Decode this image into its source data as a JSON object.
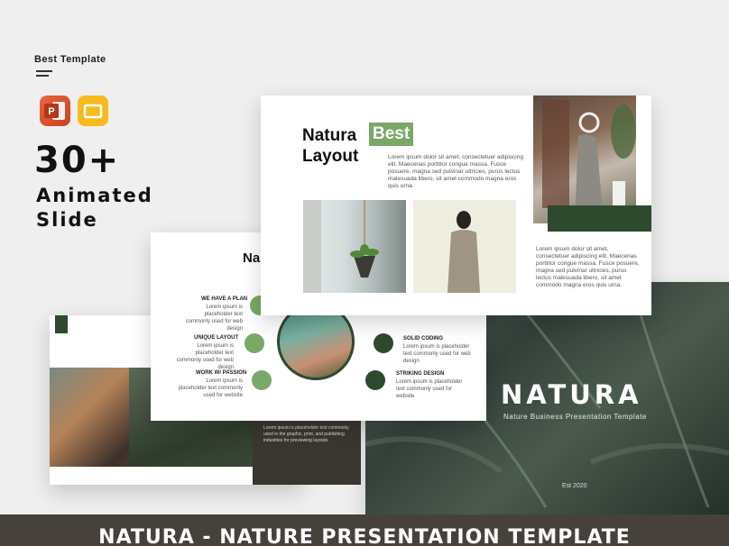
{
  "brand": {
    "name": "Best Template"
  },
  "apps": {
    "powerpoint_icon": "powerpoint-icon",
    "slides_icon": "google-slides-icon"
  },
  "promo": {
    "count": "30+",
    "line1": "Animated",
    "line2": "Slide"
  },
  "slide_layout": {
    "title_part1": "Natura",
    "title_highlight": "Best",
    "title_line2": "Layout",
    "body_top": "Lorem ipsum dolor sit amet, consectetuer adipiscing elit. Maecenas porttitor congue massa. Fusce posuere, magna sed pulvinar ultricies, purus lectus malesuada libero, sit amet commodo magna eros quis urna.",
    "body_bottom": "Lorem ipsum dolor sit amet, consectetuer adipiscing elit. Maecenas porttitor congue massa. Fusce posuere, magna sed pulvinar ultricies, purus lectus malesuada libero, sit amet commodo magna eros quis urna."
  },
  "slide_features": {
    "title_partial": "Na",
    "items": [
      {
        "title": "WE HAVE A PLAN",
        "text": "Lorem ipsum is placeholder text commonly used for web design"
      },
      {
        "title": "UNIQUE LAYOUT",
        "text": "Lorem ipsum is placeholder text commonly used for web design"
      },
      {
        "title": "WORK W/ PASSION",
        "text": "Lorem ipsum is placeholder text commonly used for website"
      },
      {
        "title": "SOLID CODING",
        "text": "Lorem ipsum is placeholder text commonly used for web design"
      },
      {
        "title": "STRIKING DESIGN",
        "text": "Lorem ipsum is placeholder text commonly used for website"
      }
    ]
  },
  "slide_cover": {
    "title": "NATURA",
    "subtitle": "Nature Business Presentation Template",
    "est": "Est 2020"
  },
  "slide_photo": {
    "text": "Lorem ipsum is placeholder text commonly used in the graphic, print, and publishing industries for previewing layouts."
  },
  "footer": {
    "title": "NATURA - NATURE PRESENTATION TEMPLATE"
  },
  "colors": {
    "accent_green": "#2d4a2f",
    "highlight_green": "#7aa867",
    "footer_bg": "#46413b"
  }
}
